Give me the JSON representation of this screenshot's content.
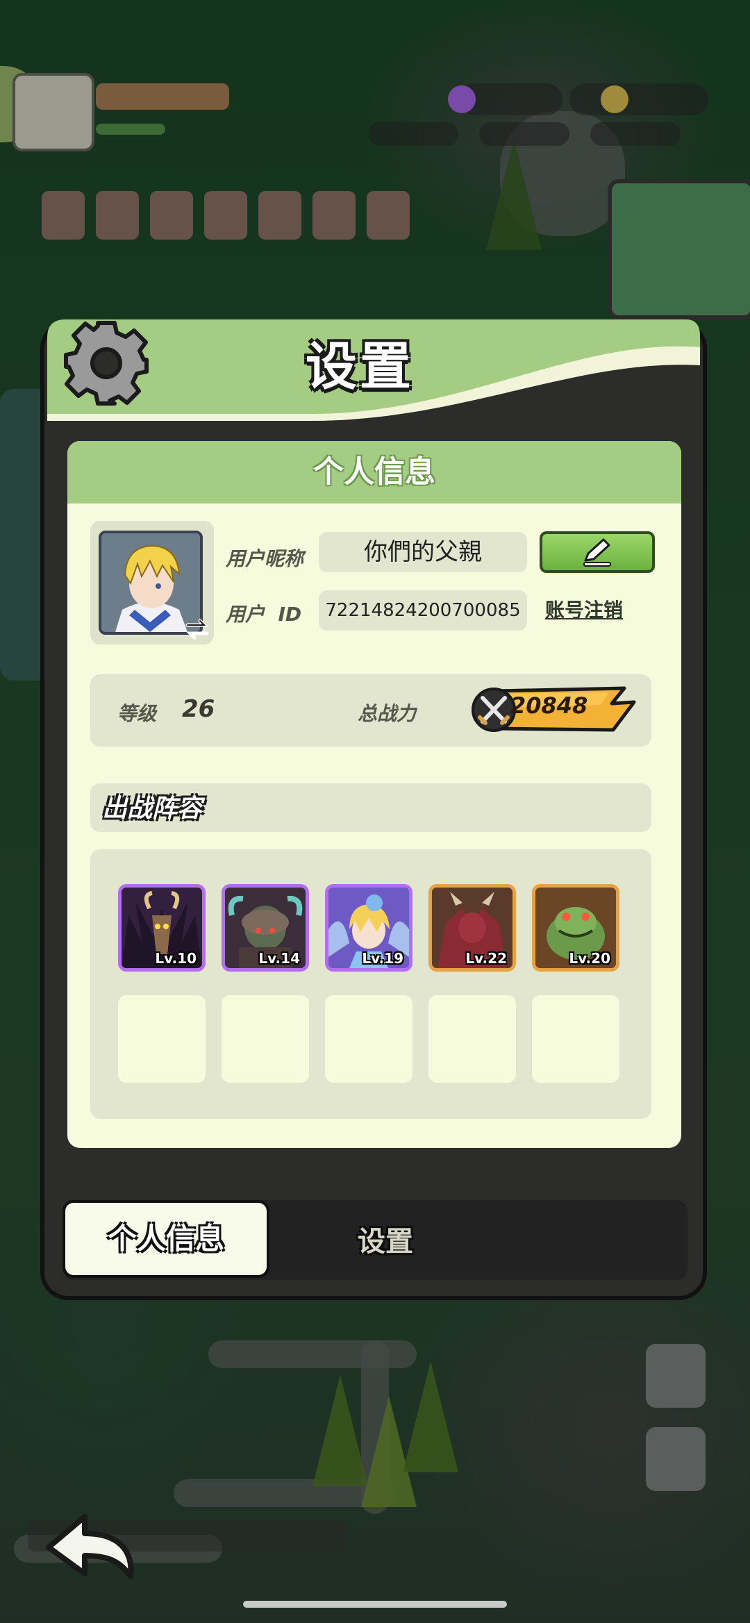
{
  "window": {
    "title": "设置"
  },
  "profile": {
    "section_title": "个人信息",
    "nickname_label": "用户昵称",
    "nickname": "你們的父親",
    "id_label": "用户  ID",
    "user_id": "72214824200700085",
    "cancel_account": "账号注销",
    "edit_icon": "pencil-icon"
  },
  "stats": {
    "level_label": "等级",
    "level": "26",
    "power_label": "总战力",
    "power": "20848"
  },
  "lineup": {
    "title": "出战阵容",
    "heroes": [
      {
        "level": "Lv.10",
        "rarity": "purple"
      },
      {
        "level": "Lv.14",
        "rarity": "purple"
      },
      {
        "level": "Lv.19",
        "rarity": "purple"
      },
      {
        "level": "Lv.22",
        "rarity": "orange"
      },
      {
        "level": "Lv.20",
        "rarity": "orange"
      }
    ],
    "empty_slots": 5
  },
  "tabs": {
    "profile": "个人信息",
    "settings": "设置",
    "active": "profile"
  },
  "colors": {
    "header_green": "#a4cc82",
    "panel_cream": "#f6fbdd",
    "purple_rarity": "#b36ef0",
    "orange_rarity": "#e8a242",
    "edit_button": "#6bb23c"
  }
}
